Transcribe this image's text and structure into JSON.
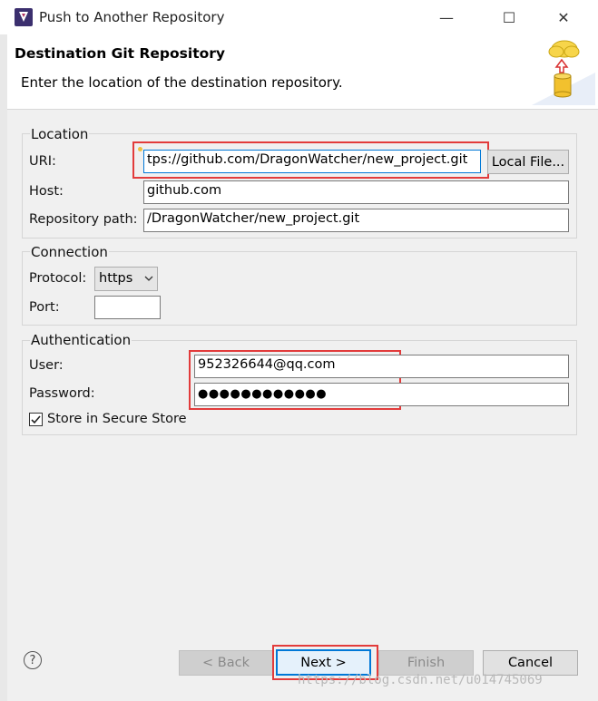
{
  "window": {
    "title": "Push to Another Repository",
    "minimize_glyph": "—",
    "maximize_glyph": "☐",
    "close_glyph": "✕"
  },
  "header": {
    "title": "Destination Git Repository",
    "description": "Enter the location of the destination repository."
  },
  "location": {
    "group_label": "Location",
    "uri_label": "URI:",
    "uri_value": "tps://github.com/DragonWatcher/new_project.git",
    "local_file_button": "Local File...",
    "host_label": "Host:",
    "host_value": "github.com",
    "repo_path_label": "Repository path:",
    "repo_path_value": "/DragonWatcher/new_project.git"
  },
  "connection": {
    "group_label": "Connection",
    "protocol_label": "Protocol:",
    "protocol_value": "https",
    "port_label": "Port:",
    "port_value": ""
  },
  "authentication": {
    "group_label": "Authentication",
    "user_label": "User:",
    "user_value": "952326644@qq.com",
    "password_label": "Password:",
    "password_value": "●●●●●●●●●●●●",
    "store_label": "Store in Secure Store",
    "store_checked": true
  },
  "footer": {
    "help_glyph": "?",
    "back_label": "< Back",
    "next_label": "Next >",
    "finish_label": "Finish",
    "cancel_label": "Cancel"
  },
  "watermark": "https://blog.csdn.net/u014745069",
  "colors": {
    "highlight": "#e23b3b",
    "focus": "#0078d7",
    "icon_arrow": "#d93030",
    "icon_cylinder": "#f2c12e",
    "icon_cloud": "#f7d54a"
  }
}
